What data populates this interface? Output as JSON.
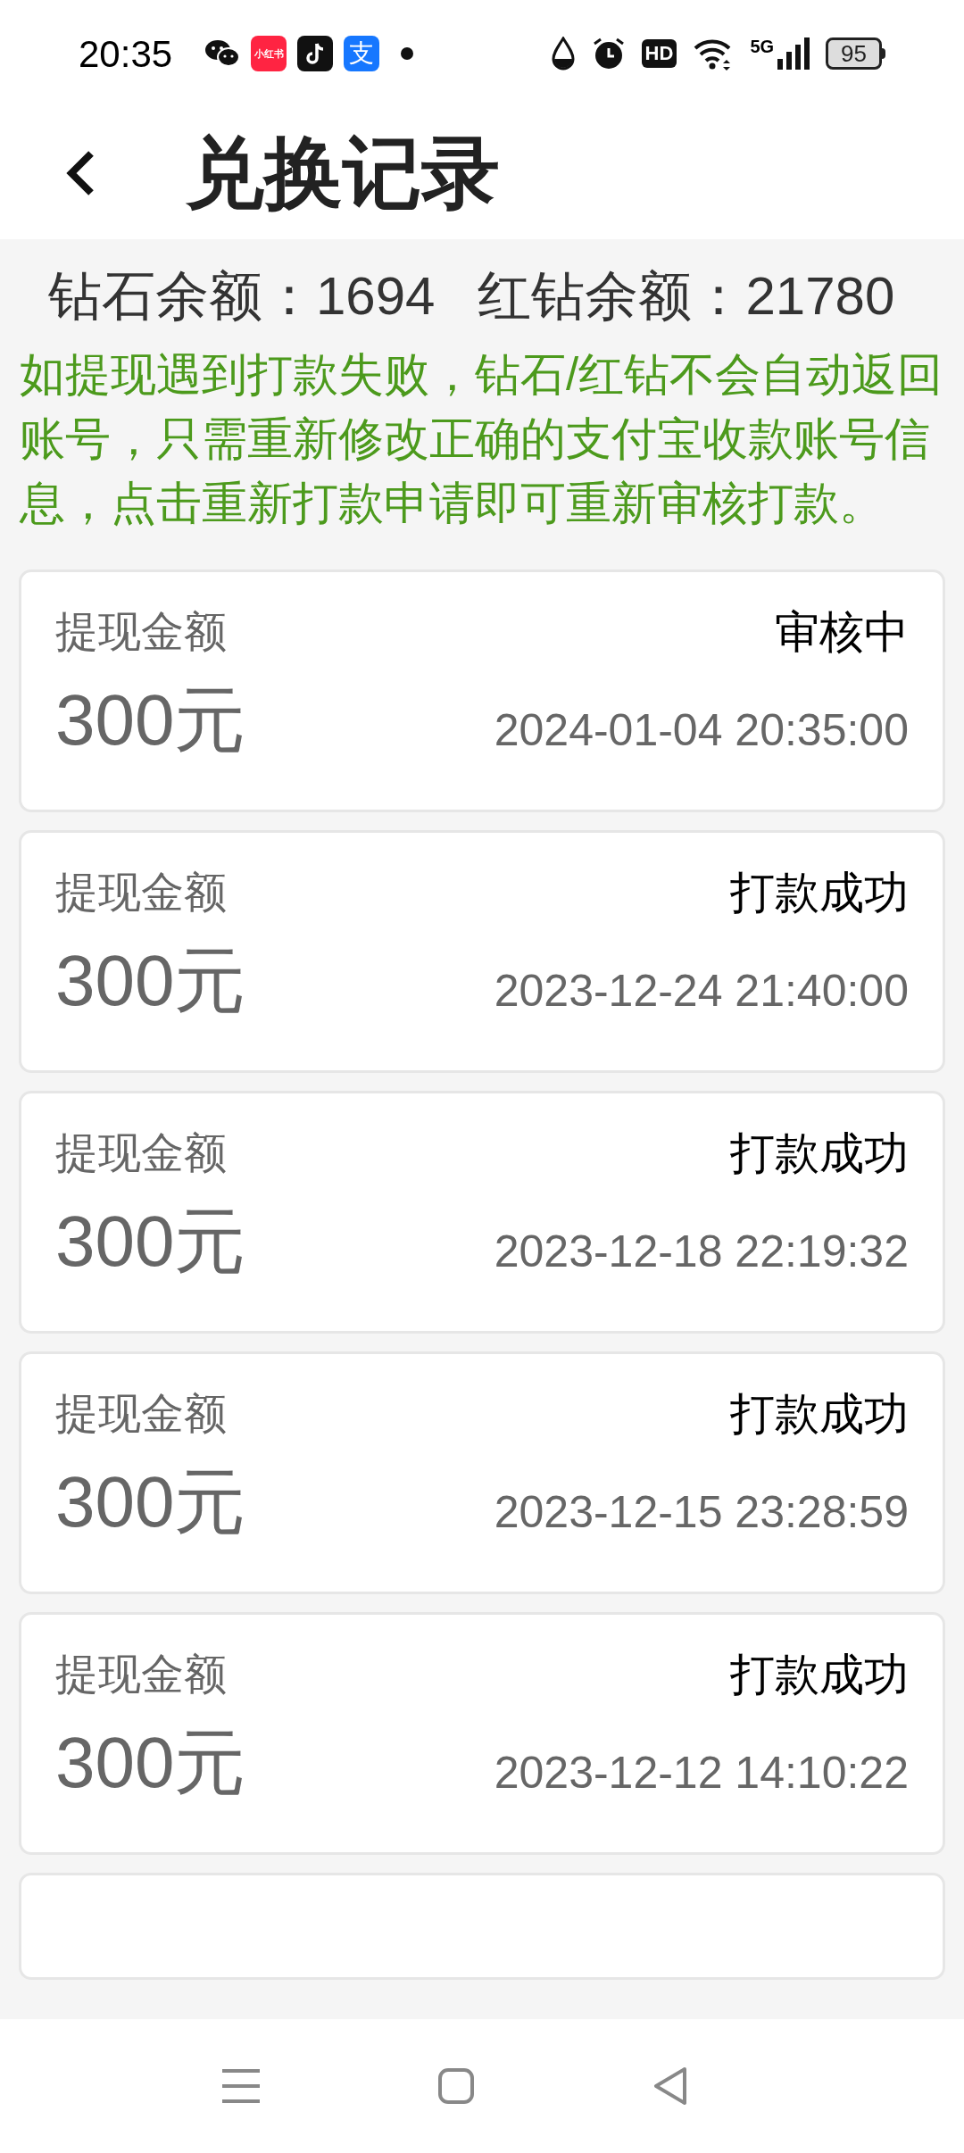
{
  "status_bar": {
    "time": "20:35",
    "apps": [
      {
        "kind": "wechat"
      },
      {
        "kind": "xiaohongshu",
        "label": "小红书"
      },
      {
        "kind": "tiktok"
      },
      {
        "kind": "alipay",
        "label": "支"
      }
    ],
    "hd": "HD",
    "network": "5G",
    "battery": "95"
  },
  "header": {
    "title": "兑换记录"
  },
  "balances": [
    {
      "label": "钻石余额：",
      "value": "1694"
    },
    {
      "label": "红钻余额：",
      "value": "21780"
    }
  ],
  "notice": "如提现遇到打款失败，钻石/红钻不会自动返回账号，只需重新修改正确的支付宝收款账号信息，点击重新打款申请即可重新审核打款。",
  "records": [
    {
      "kind": "record",
      "label": "提现金额",
      "amount": "300元",
      "status": "审核中",
      "time": "2024-01-04 20:35:00"
    },
    {
      "kind": "record",
      "label": "提现金额",
      "amount": "300元",
      "status": "打款成功",
      "time": "2023-12-24 21:40:00"
    },
    {
      "kind": "record",
      "label": "提现金额",
      "amount": "300元",
      "status": "打款成功",
      "time": "2023-12-18 22:19:32"
    },
    {
      "kind": "record",
      "label": "提现金额",
      "amount": "300元",
      "status": "打款成功",
      "time": "2023-12-15 23:28:59"
    },
    {
      "kind": "record",
      "label": "提现金额",
      "amount": "300元",
      "status": "打款成功",
      "time": "2023-12-12 14:10:22"
    },
    {
      "kind": "cut_off"
    }
  ]
}
